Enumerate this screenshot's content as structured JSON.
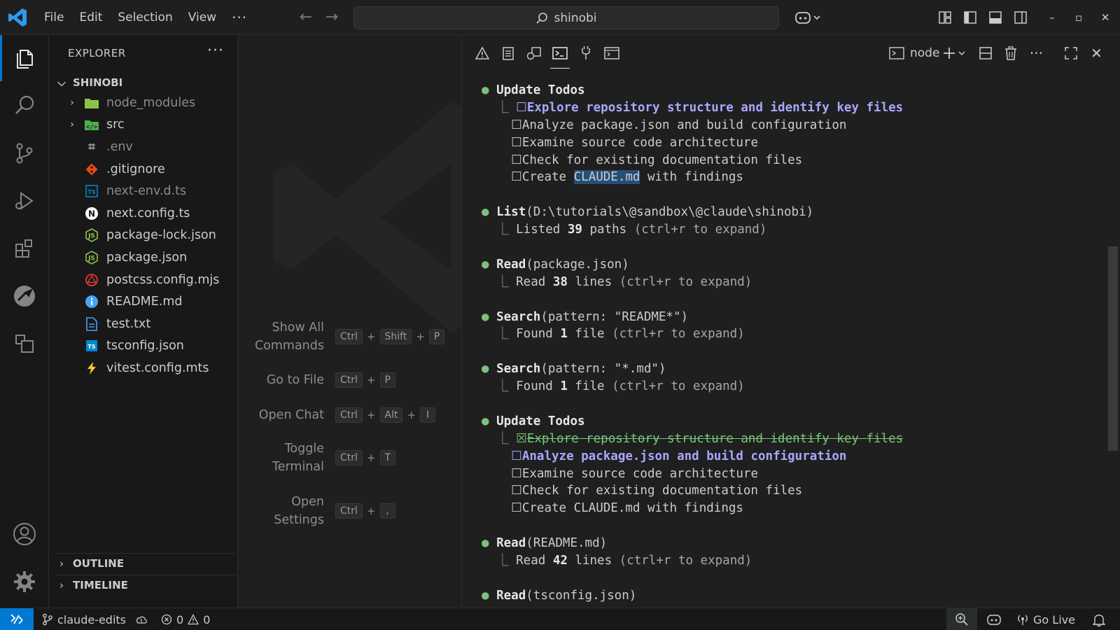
{
  "menu": {
    "file": "File",
    "edit": "Edit",
    "selection": "Selection",
    "view": "View",
    "more": "···"
  },
  "command_center": {
    "text": "shinobi"
  },
  "window_controls": {
    "minimize": "–",
    "maximize": "▫",
    "close": "✕"
  },
  "explorer": {
    "title": "EXPLORER",
    "more": "···",
    "folder": "SHINOBI",
    "items": [
      {
        "name": "node_modules",
        "kind": "folder",
        "icon": "node-modules-folder-icon",
        "color": "#8bc34a"
      },
      {
        "name": "src",
        "kind": "folder",
        "icon": "src-folder-icon",
        "color": "#4caf50"
      },
      {
        "name": ".env",
        "kind": "file",
        "icon": "env-file-icon",
        "color": "#9c9c9c"
      },
      {
        "name": ".gitignore",
        "kind": "file",
        "icon": "git-file-icon",
        "color": "#e64a19"
      },
      {
        "name": "next-env.d.ts",
        "kind": "file",
        "icon": "typescript-def-file-icon",
        "color": "#0288d1"
      },
      {
        "name": "next.config.ts",
        "kind": "file",
        "icon": "nextjs-file-icon",
        "color": "#ffffff"
      },
      {
        "name": "package-lock.json",
        "kind": "file",
        "icon": "npm-lock-file-icon",
        "color": "#8bc34a"
      },
      {
        "name": "package.json",
        "kind": "file",
        "icon": "npm-file-icon",
        "color": "#8bc34a"
      },
      {
        "name": "postcss.config.mjs",
        "kind": "file",
        "icon": "postcss-file-icon",
        "color": "#e53935"
      },
      {
        "name": "README.md",
        "kind": "file",
        "icon": "readme-info-icon",
        "color": "#42a5f5"
      },
      {
        "name": "test.txt",
        "kind": "file",
        "icon": "text-file-icon",
        "color": "#42a5f5"
      },
      {
        "name": "tsconfig.json",
        "kind": "file",
        "icon": "tsconfig-file-icon",
        "color": "#0288d1"
      },
      {
        "name": "vitest.config.mts",
        "kind": "file",
        "icon": "vitest-file-icon",
        "color": "#fcc72b"
      }
    ],
    "outline": "OUTLINE",
    "timeline": "TIMELINE"
  },
  "shortcuts": [
    {
      "label": "Show All Commands",
      "keys": [
        "Ctrl",
        "Shift",
        "P"
      ]
    },
    {
      "label": "Go to File",
      "keys": [
        "Ctrl",
        "P"
      ]
    },
    {
      "label": "Open Chat",
      "keys": [
        "Ctrl",
        "Alt",
        "I"
      ]
    },
    {
      "label": "Toggle Terminal",
      "keys": [
        "Ctrl",
        "T"
      ]
    },
    {
      "label": "Open Settings",
      "keys": [
        "Ctrl",
        ","
      ]
    }
  ],
  "panel": {
    "terminal_name": "node"
  },
  "terminal": {
    "bullet": "●",
    "branch": "⎿",
    "unchecked": "☐",
    "checked": "☒",
    "update_todos": "Update Todos",
    "todo1": "Explore repository structure and identify key files",
    "todo2": "Analyze package.json and build configuration",
    "todo3": "Examine source code architecture",
    "todo4": "Check for existing documentation files",
    "todo5_pre": "Create ",
    "todo5_sel": "CLAUDE.md",
    "todo5_post": " with findings",
    "todo5_full": "Create CLAUDE.md with findings",
    "list_tool": "List",
    "list_args": "(D:\\tutorials\\@sandbox\\@claude\\shinobi)",
    "listed": "Listed ",
    "listed_n": "39",
    "listed_unit": " paths ",
    "expand_hint": "(ctrl+r to expand)",
    "read_tool": "Read",
    "read_pkg_args": "(package.json)",
    "read_word": "Read ",
    "read_pkg_n": "38",
    "lines_unit": " lines ",
    "search_tool": "Search",
    "search1_args": "(pattern: \"README*\")",
    "found_word": "Found ",
    "found_n": "1",
    "file_unit": " file ",
    "search2_args": "(pattern: \"*.md\")",
    "read_readme_args": "(README.md)",
    "read_readme_n": "42",
    "read_tsconfig_args": "(tsconfig.json)"
  },
  "statusbar": {
    "branch": "claude-edits",
    "errors": "0",
    "warnings": "0",
    "go_live": "Go Live"
  },
  "colors": {
    "accent": "#0078d4",
    "highlight_todo": "#a9a7ff",
    "done_todo": "#79c779",
    "bullet": "#7fbf7f"
  }
}
